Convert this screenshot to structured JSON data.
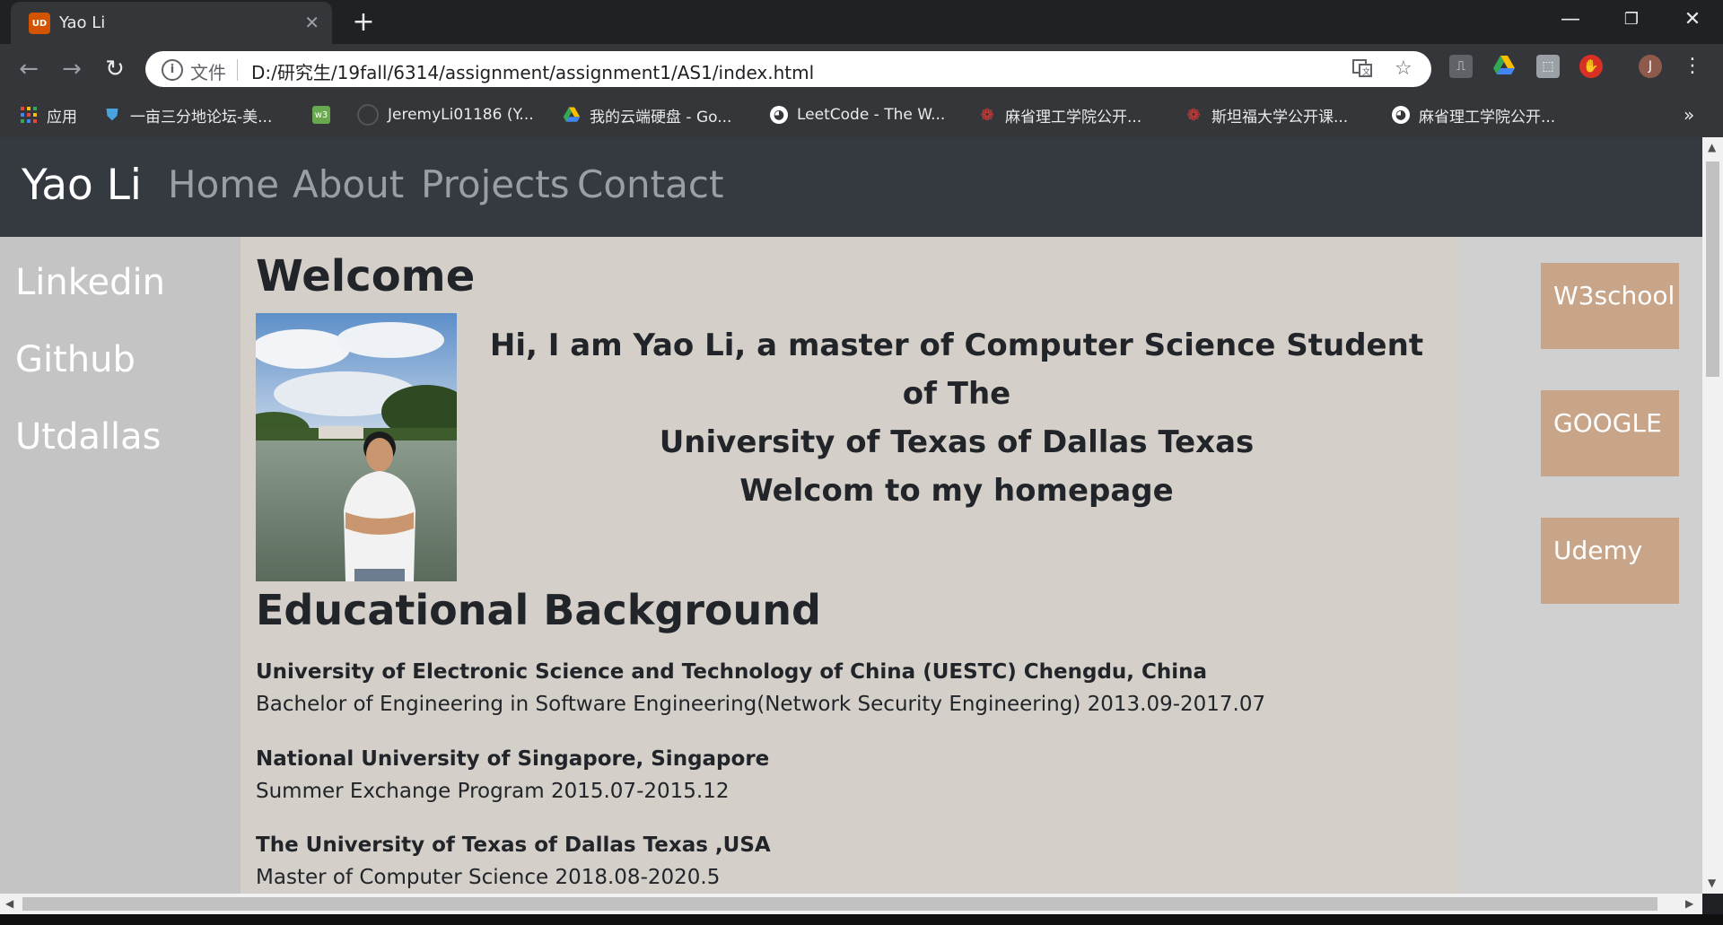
{
  "browser": {
    "tab": {
      "title": "Yao Li",
      "favicon": "UD"
    },
    "new_tab_icon": "+",
    "window_controls": {
      "minimize": "—",
      "restore": "❐",
      "close": "✕"
    },
    "nav": {
      "back": "←",
      "forward": "→",
      "reload": "↻"
    },
    "omnibox": {
      "info_icon": "i",
      "scheme_label": "文件",
      "url": "D:/研究生/19fall/6314/assignment/assignment1/AS1/index.html"
    },
    "bookmarks": [
      {
        "label": "应用",
        "icon": "apps-grid-icon",
        "color": "#e8453c"
      },
      {
        "label": "一亩三分地论坛-美...",
        "icon": "forum-icon",
        "color": "#1a73e8"
      },
      {
        "label": "",
        "icon": "w3-icon",
        "color": "#6aa84f"
      },
      {
        "label": "JeremyLi01186 (Y...",
        "icon": "github-icon",
        "color": "#555555"
      },
      {
        "label": "我的云端硬盘 - Go...",
        "icon": "drive-icon",
        "color": "#fbbc04"
      },
      {
        "label": "LeetCode - The W...",
        "icon": "globe-icon",
        "color": "#ffffff"
      },
      {
        "label": "麻省理工学院公开...",
        "icon": "netease-icon",
        "color": "#d32f2f"
      },
      {
        "label": "斯坦福大学公开课...",
        "icon": "netease-icon",
        "color": "#d32f2f"
      },
      {
        "label": "麻省理工学院公开...",
        "icon": "globe-icon",
        "color": "#ffffff"
      }
    ],
    "bookmarks_overflow": "»",
    "profile_initial": "J"
  },
  "site": {
    "brand": "Yao Li",
    "nav": [
      "Home",
      "About",
      "Projects",
      "Contact"
    ],
    "left_links": [
      "Linkedin",
      "Github",
      "Utdallas"
    ],
    "right_links": [
      "W3school",
      "GOOGLE",
      "Udemy"
    ],
    "welcome": "Welcome",
    "intro": [
      "Hi, I am Yao Li, a master of Computer Science Student of The",
      "University of Texas of Dallas Texas",
      "Welcom to my homepage"
    ],
    "education_heading": "Educational Background",
    "education": [
      {
        "school": "University of Electronic Science and Technology of China (UESTC) Chengdu, China",
        "detail": "Bachelor of Engineering in Software Engineering(Network Security Engineering) 2013.09-2017.07"
      },
      {
        "school": "National University of Singapore, Singapore",
        "detail": "Summer Exchange Program 2015.07-2015.12"
      },
      {
        "school": "The University of Texas of Dallas Texas ,USA",
        "detail": "Master of Computer Science 2018.08-2020.5"
      }
    ]
  },
  "colors": {
    "header": "#343a40",
    "main_bg": "#d5cfc9",
    "left_sidebar": "#c4c4c4",
    "link_box": "#c8a589"
  }
}
